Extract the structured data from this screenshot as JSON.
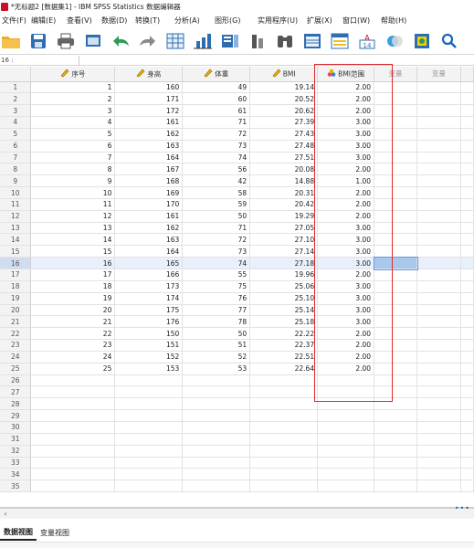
{
  "window": {
    "title": "*无标题2 [数据集1] - IBM SPSS Statistics 数据编辑器"
  },
  "menu": [
    "文件(F)",
    "编辑(E)",
    "查看(V)",
    "数据(D)",
    "转换(T)",
    "分析(A)",
    "图形(G)",
    "实用程序(U)",
    "扩展(X)",
    "窗口(W)",
    "帮助(H)"
  ],
  "toolbar_icons": [
    "open-folder-icon",
    "save-icon",
    "print-icon",
    "recall-dialog-icon",
    "undo-icon",
    "redo-icon",
    "goto-case-icon",
    "goto-variable-icon",
    "variables-icon",
    "descriptives-icon",
    "find-icon",
    "split-file-icon",
    "weight-cases-icon",
    "value-labels-icon",
    "use-sets-icon",
    "show-sets-icon",
    "search-icon"
  ],
  "cell_bar": {
    "reference": "16 :",
    "value": ""
  },
  "columns": [
    {
      "label": "序号",
      "type": "scale",
      "icon": "ruler-icon"
    },
    {
      "label": "身高",
      "type": "scale",
      "icon": "ruler-icon"
    },
    {
      "label": "体重",
      "type": "scale",
      "icon": "ruler-icon"
    },
    {
      "label": "BMI",
      "type": "scale",
      "icon": "ruler-icon"
    },
    {
      "label": "BMI范围",
      "type": "nominal",
      "icon": "nominal-icon"
    },
    {
      "label": "变量",
      "type": "empty"
    },
    {
      "label": "变量",
      "type": "empty"
    }
  ],
  "rows": [
    [
      "1",
      "160",
      "49",
      "19.14",
      "2.00"
    ],
    [
      "2",
      "171",
      "60",
      "20.52",
      "2.00"
    ],
    [
      "3",
      "172",
      "61",
      "20.62",
      "2.00"
    ],
    [
      "4",
      "161",
      "71",
      "27.39",
      "3.00"
    ],
    [
      "5",
      "162",
      "72",
      "27.43",
      "3.00"
    ],
    [
      "6",
      "163",
      "73",
      "27.48",
      "3.00"
    ],
    [
      "7",
      "164",
      "74",
      "27.51",
      "3.00"
    ],
    [
      "8",
      "167",
      "56",
      "20.08",
      "2.00"
    ],
    [
      "9",
      "168",
      "42",
      "14.88",
      "1.00"
    ],
    [
      "10",
      "169",
      "58",
      "20.31",
      "2.00"
    ],
    [
      "11",
      "170",
      "59",
      "20.42",
      "2.00"
    ],
    [
      "12",
      "161",
      "50",
      "19.29",
      "2.00"
    ],
    [
      "13",
      "162",
      "71",
      "27.05",
      "3.00"
    ],
    [
      "14",
      "163",
      "72",
      "27.10",
      "3.00"
    ],
    [
      "15",
      "164",
      "73",
      "27.14",
      "3.00"
    ],
    [
      "16",
      "165",
      "74",
      "27.18",
      "3.00"
    ],
    [
      "17",
      "166",
      "55",
      "19.96",
      "2.00"
    ],
    [
      "18",
      "173",
      "75",
      "25.06",
      "3.00"
    ],
    [
      "19",
      "174",
      "76",
      "25.10",
      "3.00"
    ],
    [
      "20",
      "175",
      "77",
      "25.14",
      "3.00"
    ],
    [
      "21",
      "176",
      "78",
      "25.18",
      "3.00"
    ],
    [
      "22",
      "150",
      "50",
      "22.22",
      "2.00"
    ],
    [
      "23",
      "151",
      "51",
      "22.37",
      "2.00"
    ],
    [
      "24",
      "152",
      "52",
      "22.51",
      "2.00"
    ],
    [
      "25",
      "153",
      "53",
      "22.64",
      "2.00"
    ]
  ],
  "row_count": 35,
  "selected_row": 16,
  "colors": {
    "accent": "#1565c0",
    "highlight_box": "#e02a2a",
    "active_cell": "#a9c8ee"
  },
  "tabs": [
    "数据视图",
    "变量视图"
  ],
  "active_tab": 0
}
